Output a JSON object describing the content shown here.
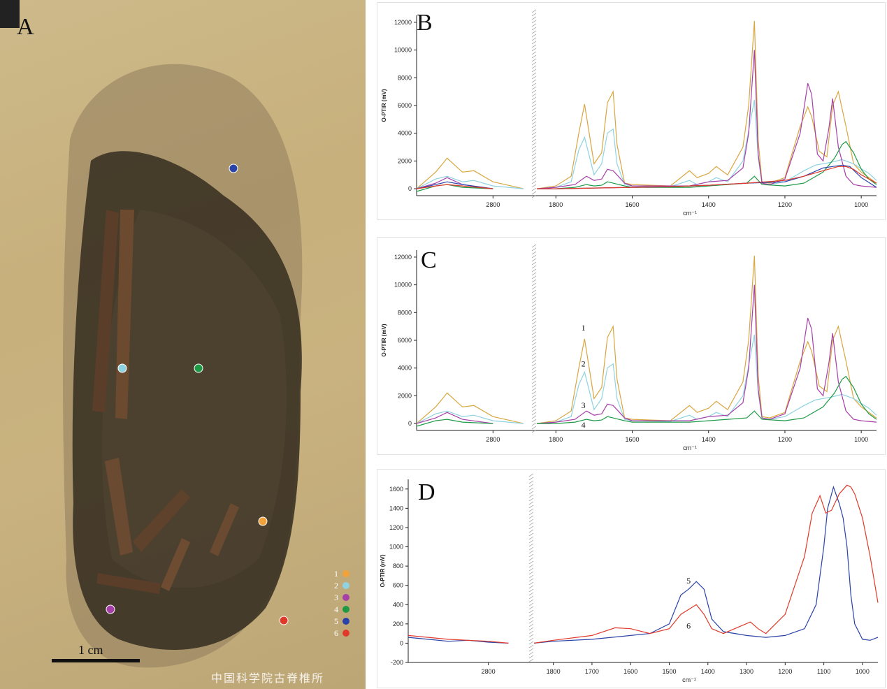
{
  "panel_a": {
    "letter": "A",
    "scale_bar_label": "1 cm",
    "watermark": "中国科学院古脊椎所",
    "legend": [
      {
        "num": "1",
        "color": "#f2a23a"
      },
      {
        "num": "2",
        "color": "#8fd3e0"
      },
      {
        "num": "3",
        "color": "#a63fa8"
      },
      {
        "num": "4",
        "color": "#1e9a45"
      },
      {
        "num": "5",
        "color": "#2a43a8"
      },
      {
        "num": "6",
        "color": "#e0392a"
      }
    ]
  },
  "chart_data": [
    {
      "panel": "B",
      "type": "line",
      "ylabel": "O-PTIR (mV)",
      "xlabel": "cm⁻¹",
      "ylim": [
        -500,
        12500
      ],
      "yticks": [
        0,
        2000,
        4000,
        6000,
        8000,
        10000,
        12000
      ],
      "xticks": [
        2800,
        1800,
        1600,
        1400,
        1200,
        1000
      ],
      "series": [
        {
          "color": "#d9a640",
          "x": [
            3000,
            2950,
            2920,
            2880,
            2850,
            2800,
            2720,
            1850,
            1800,
            1760,
            1740,
            1725,
            1700,
            1680,
            1665,
            1650,
            1640,
            1620,
            1600,
            1500,
            1450,
            1430,
            1400,
            1380,
            1350,
            1310,
            1295,
            1280,
            1270,
            1260,
            1240,
            1200,
            1160,
            1140,
            1130,
            1110,
            1090,
            1075,
            1060,
            1040,
            1020,
            1000,
            960
          ],
          "y": [
            0,
            1200,
            2200,
            1200,
            1300,
            500,
            0,
            0,
            200,
            900,
            4000,
            6100,
            1800,
            2600,
            6200,
            7000,
            3200,
            400,
            300,
            200,
            1300,
            800,
            1100,
            1600,
            1000,
            3000,
            6000,
            12100,
            3500,
            500,
            400,
            800,
            4500,
            5900,
            5200,
            2700,
            2300,
            6000,
            7000,
            4500,
            1800,
            1200,
            400
          ]
        },
        {
          "color": "#8fd3e0",
          "x": [
            3000,
            2950,
            2920,
            2880,
            2850,
            2800,
            2720,
            1850,
            1800,
            1760,
            1740,
            1725,
            1700,
            1680,
            1665,
            1650,
            1640,
            1620,
            1600,
            1500,
            1450,
            1430,
            1400,
            1380,
            1350,
            1310,
            1295,
            1280,
            1270,
            1260,
            1240,
            1200,
            1150,
            1120,
            1080,
            1050,
            1020,
            980,
            960
          ],
          "y": [
            0,
            700,
            900,
            500,
            600,
            200,
            0,
            0,
            100,
            500,
            2800,
            3700,
            1000,
            1800,
            4000,
            4300,
            1800,
            300,
            200,
            150,
            600,
            300,
            500,
            800,
            500,
            2000,
            4200,
            6400,
            2200,
            400,
            300,
            500,
            1300,
            1700,
            1900,
            2100,
            1800,
            1100,
            600
          ]
        },
        {
          "color": "#a63fa8",
          "x": [
            3000,
            2950,
            2920,
            2880,
            2800,
            1850,
            1800,
            1750,
            1720,
            1700,
            1680,
            1665,
            1650,
            1620,
            1600,
            1450,
            1400,
            1350,
            1310,
            1295,
            1280,
            1270,
            1260,
            1240,
            1200,
            1160,
            1140,
            1130,
            1115,
            1100,
            1085,
            1075,
            1060,
            1040,
            1020,
            1000,
            960
          ],
          "y": [
            0,
            400,
            800,
            300,
            0,
            0,
            100,
            300,
            900,
            600,
            700,
            1400,
            1300,
            400,
            200,
            200,
            500,
            600,
            1500,
            4000,
            10000,
            2500,
            400,
            300,
            700,
            4000,
            7600,
            6800,
            2500,
            2000,
            4300,
            6500,
            3000,
            900,
            300,
            200,
            100
          ]
        },
        {
          "color": "#1e9a45",
          "x": [
            3000,
            2950,
            2920,
            2880,
            2800,
            1850,
            1800,
            1750,
            1720,
            1700,
            1680,
            1665,
            1650,
            1620,
            1600,
            1450,
            1400,
            1350,
            1300,
            1280,
            1260,
            1200,
            1150,
            1100,
            1070,
            1050,
            1040,
            1020,
            1000,
            980,
            960
          ],
          "y": [
            -200,
            200,
            300,
            100,
            0,
            0,
            0,
            100,
            300,
            200,
            250,
            500,
            400,
            200,
            100,
            100,
            200,
            300,
            400,
            900,
            300,
            200,
            400,
            1200,
            2200,
            3200,
            3400,
            2600,
            1400,
            700,
            300
          ]
        },
        {
          "color": "#2a43a8",
          "x": [
            3000,
            2950,
            2920,
            2880,
            2800,
            1850,
            1800,
            1700,
            1600,
            1500,
            1400,
            1300,
            1200,
            1150,
            1100,
            1050,
            1030,
            1000,
            960
          ],
          "y": [
            0,
            300,
            500,
            300,
            0,
            0,
            0,
            50,
            100,
            150,
            250,
            400,
            500,
            900,
            1500,
            1700,
            1600,
            800,
            100
          ]
        },
        {
          "color": "#e0392a",
          "x": [
            3000,
            2950,
            2920,
            2880,
            2800,
            1850,
            1800,
            1700,
            1600,
            1500,
            1400,
            1300,
            1200,
            1150,
            1100,
            1060,
            1040,
            1020,
            1000,
            960
          ],
          "y": [
            0,
            200,
            300,
            200,
            0,
            0,
            0,
            50,
            100,
            150,
            250,
            400,
            600,
            900,
            1300,
            1600,
            1600,
            1400,
            1000,
            400
          ]
        }
      ]
    },
    {
      "panel": "C",
      "type": "line",
      "ylabel": "O-PTIR (mV)",
      "xlabel": "cm⁻¹",
      "ylim": [
        -500,
        12500
      ],
      "yticks": [
        0,
        2000,
        4000,
        6000,
        8000,
        10000,
        12000
      ],
      "xticks": [
        2800,
        1800,
        1600,
        1400,
        1200,
        1000
      ],
      "annotations": [
        {
          "text": "1",
          "x": 1728,
          "y": 6700
        },
        {
          "text": "2",
          "x": 1728,
          "y": 4100
        },
        {
          "text": "3",
          "x": 1728,
          "y": 1100
        },
        {
          "text": "4",
          "x": 1728,
          "y": -300
        }
      ],
      "series": [
        {
          "color": "#d9a640",
          "x": [
            3000,
            2950,
            2920,
            2880,
            2850,
            2800,
            2720,
            1850,
            1800,
            1760,
            1740,
            1725,
            1700,
            1680,
            1665,
            1650,
            1640,
            1620,
            1600,
            1500,
            1450,
            1430,
            1400,
            1380,
            1350,
            1310,
            1295,
            1280,
            1270,
            1260,
            1240,
            1200,
            1160,
            1140,
            1130,
            1110,
            1090,
            1075,
            1060,
            1040,
            1020,
            1000,
            960
          ],
          "y": [
            0,
            1200,
            2200,
            1200,
            1300,
            500,
            0,
            0,
            200,
            900,
            4000,
            6100,
            1800,
            2600,
            6200,
            7000,
            3200,
            400,
            300,
            200,
            1300,
            800,
            1100,
            1600,
            1000,
            3000,
            6000,
            12100,
            3500,
            500,
            400,
            800,
            4500,
            5900,
            5200,
            2700,
            2300,
            6000,
            7000,
            4500,
            1800,
            1200,
            400
          ]
        },
        {
          "color": "#8fd3e0",
          "x": [
            3000,
            2950,
            2920,
            2880,
            2850,
            2800,
            2720,
            1850,
            1800,
            1760,
            1740,
            1725,
            1700,
            1680,
            1665,
            1650,
            1640,
            1620,
            1600,
            1500,
            1450,
            1430,
            1400,
            1380,
            1350,
            1310,
            1295,
            1280,
            1270,
            1260,
            1240,
            1200,
            1150,
            1120,
            1080,
            1050,
            1020,
            980,
            960
          ],
          "y": [
            0,
            700,
            900,
            500,
            600,
            200,
            0,
            0,
            100,
            500,
            2800,
            3700,
            1000,
            1800,
            4000,
            4300,
            1800,
            300,
            200,
            150,
            600,
            300,
            500,
            800,
            500,
            2000,
            4200,
            6400,
            2200,
            400,
            300,
            500,
            1300,
            1700,
            1900,
            2100,
            1800,
            1100,
            600
          ]
        },
        {
          "color": "#a63fa8",
          "x": [
            3000,
            2950,
            2920,
            2880,
            2800,
            1850,
            1800,
            1750,
            1720,
            1700,
            1680,
            1665,
            1650,
            1620,
            1600,
            1450,
            1400,
            1350,
            1310,
            1295,
            1280,
            1270,
            1260,
            1240,
            1200,
            1160,
            1140,
            1130,
            1115,
            1100,
            1085,
            1075,
            1060,
            1040,
            1020,
            1000,
            960
          ],
          "y": [
            0,
            400,
            800,
            300,
            0,
            0,
            100,
            300,
            900,
            600,
            700,
            1400,
            1300,
            400,
            200,
            200,
            500,
            600,
            1500,
            4000,
            10000,
            2500,
            400,
            300,
            700,
            4000,
            7600,
            6800,
            2500,
            2000,
            4300,
            6500,
            3000,
            900,
            300,
            200,
            100
          ]
        },
        {
          "color": "#1e9a45",
          "x": [
            3000,
            2950,
            2920,
            2880,
            2800,
            1850,
            1800,
            1750,
            1720,
            1700,
            1680,
            1665,
            1650,
            1620,
            1600,
            1450,
            1400,
            1350,
            1300,
            1280,
            1260,
            1200,
            1150,
            1100,
            1070,
            1050,
            1040,
            1020,
            1000,
            980,
            960
          ],
          "y": [
            -200,
            200,
            300,
            100,
            0,
            0,
            0,
            100,
            300,
            200,
            250,
            500,
            400,
            200,
            100,
            100,
            200,
            300,
            400,
            900,
            300,
            200,
            400,
            1200,
            2200,
            3200,
            3400,
            2600,
            1400,
            700,
            300
          ]
        }
      ]
    },
    {
      "panel": "D",
      "type": "line",
      "ylabel": "O-PTIR (mV)",
      "xlabel": "cm⁻¹",
      "ylim": [
        -200,
        1700
      ],
      "yticks": [
        -200,
        0,
        200,
        400,
        600,
        800,
        1000,
        1200,
        1400,
        1600
      ],
      "xticks": [
        2800,
        1800,
        1700,
        1600,
        1500,
        1400,
        1300,
        1200,
        1100,
        1000
      ],
      "annotations": [
        {
          "text": "5",
          "x": 1450,
          "y": 620
        },
        {
          "text": "6",
          "x": 1450,
          "y": 150
        }
      ],
      "series": [
        {
          "color": "#2a43a8",
          "x": [
            3000,
            2950,
            2900,
            2850,
            2800,
            2750,
            1850,
            1800,
            1700,
            1600,
            1550,
            1500,
            1470,
            1450,
            1430,
            1410,
            1390,
            1360,
            1300,
            1250,
            1200,
            1150,
            1120,
            1100,
            1090,
            1075,
            1060,
            1050,
            1040,
            1030,
            1020,
            1000,
            980,
            960
          ],
          "y": [
            60,
            40,
            20,
            30,
            10,
            0,
            0,
            20,
            40,
            80,
            100,
            200,
            500,
            560,
            640,
            560,
            250,
            120,
            80,
            60,
            80,
            150,
            400,
            1000,
            1400,
            1620,
            1450,
            1300,
            1000,
            500,
            200,
            40,
            30,
            60
          ]
        },
        {
          "color": "#e0392a",
          "x": [
            3000,
            2950,
            2900,
            2850,
            2800,
            2750,
            1850,
            1800,
            1700,
            1640,
            1600,
            1550,
            1500,
            1470,
            1450,
            1430,
            1410,
            1390,
            1360,
            1290,
            1270,
            1250,
            1200,
            1150,
            1130,
            1110,
            1095,
            1080,
            1060,
            1040,
            1030,
            1020,
            1000,
            980,
            960
          ],
          "y": [
            80,
            60,
            40,
            30,
            20,
            0,
            0,
            30,
            80,
            160,
            150,
            100,
            150,
            300,
            350,
            400,
            300,
            150,
            100,
            220,
            150,
            100,
            300,
            900,
            1350,
            1530,
            1350,
            1380,
            1550,
            1640,
            1620,
            1550,
            1300,
            900,
            420
          ]
        }
      ]
    }
  ]
}
